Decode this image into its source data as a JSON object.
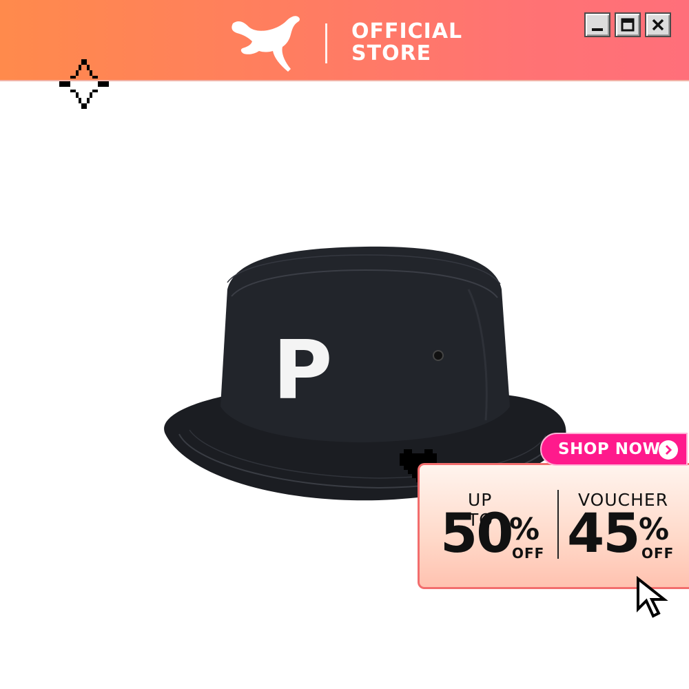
{
  "header": {
    "brand_logo": "puma-cat-logo",
    "store_line1": "OFFICIAL",
    "store_line2": "STORE",
    "window_controls": [
      "minimize",
      "maximize",
      "close"
    ]
  },
  "product": {
    "image": "black-bucket-hat",
    "emblem_letter": "P"
  },
  "promo": {
    "cta_label": "SHOP NOW",
    "left": {
      "caption": "UP TO",
      "value": "50",
      "percent": "%",
      "suffix": "OFF"
    },
    "right": {
      "caption": "VOUCHER",
      "value": "45",
      "percent": "%",
      "suffix": "OFF"
    }
  },
  "decorations": [
    "sparkle-icon",
    "heart-icon",
    "cursor-icon"
  ],
  "colors": {
    "header_start": "#ff8a4c",
    "header_end": "#ff6f7a",
    "cta_pink": "#ff1a8c",
    "promo_border": "#f26d6d"
  }
}
